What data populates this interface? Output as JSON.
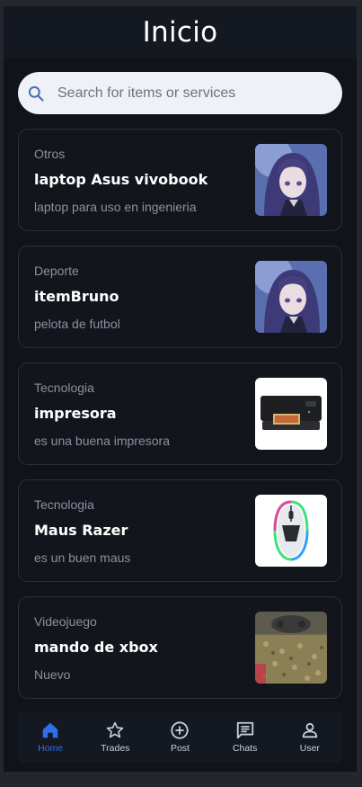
{
  "header": {
    "title": "Inicio"
  },
  "search": {
    "placeholder": "Search for items or services",
    "icon": "search-icon"
  },
  "items": [
    {
      "category": "Otros",
      "title": "laptop Asus vivobook",
      "description": "laptop para uso en ingenieria",
      "image": "anime-girl-image"
    },
    {
      "category": "Deporte",
      "title": "itemBruno",
      "description": "pelota de futbol",
      "image": "anime-girl-image"
    },
    {
      "category": "Tecnologia",
      "title": "impresora",
      "description": "es una buena impresora",
      "image": "printer-image"
    },
    {
      "category": "Tecnologia",
      "title": "Maus Razer",
      "description": "es un buen maus",
      "image": "mouse-image"
    },
    {
      "category": "Videojuego",
      "title": "mando de xbox",
      "description": "Nuevo",
      "image": "controller-image"
    }
  ],
  "nav": {
    "items": [
      {
        "label": "Home",
        "icon": "home-icon",
        "active": true
      },
      {
        "label": "Trades",
        "icon": "star-icon",
        "active": false
      },
      {
        "label": "Post",
        "icon": "plus-circle-icon",
        "active": false
      },
      {
        "label": "Chats",
        "icon": "chat-icon",
        "active": false
      },
      {
        "label": "User",
        "icon": "user-icon",
        "active": false
      }
    ]
  },
  "colors": {
    "background": "#10131a",
    "header": "#141820",
    "accent": "#2f6fe8",
    "muted_text": "#8a919e"
  }
}
